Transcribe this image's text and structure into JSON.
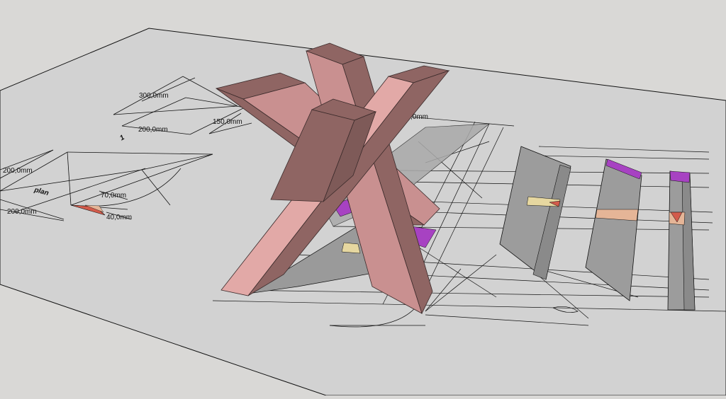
{
  "scene": {
    "background": "#d9d8d6",
    "ground_color": "#d2d2d2",
    "beam_colors": {
      "light": "#e2a9a7",
      "mid": "#c99090",
      "dark": "#8f6563",
      "shadow_face": "#7e5a58"
    },
    "section_colors": {
      "gray": "#9c9c9c",
      "purple": "#a742c2",
      "salmon": "#e5b597",
      "yellow": "#e6d7a0",
      "red": "#d35b4b"
    }
  },
  "dimensions": {
    "d300": "300,0mm",
    "d200_top": "200,0mm",
    "d150": "150,0mm",
    "d200_left": "200,0mm",
    "d200_bottom": "200,0mm",
    "d70": "70,0mm",
    "d40": "40,0mm",
    "partial": ",0mm"
  },
  "labels": {
    "one": "1",
    "plan": "plan"
  }
}
